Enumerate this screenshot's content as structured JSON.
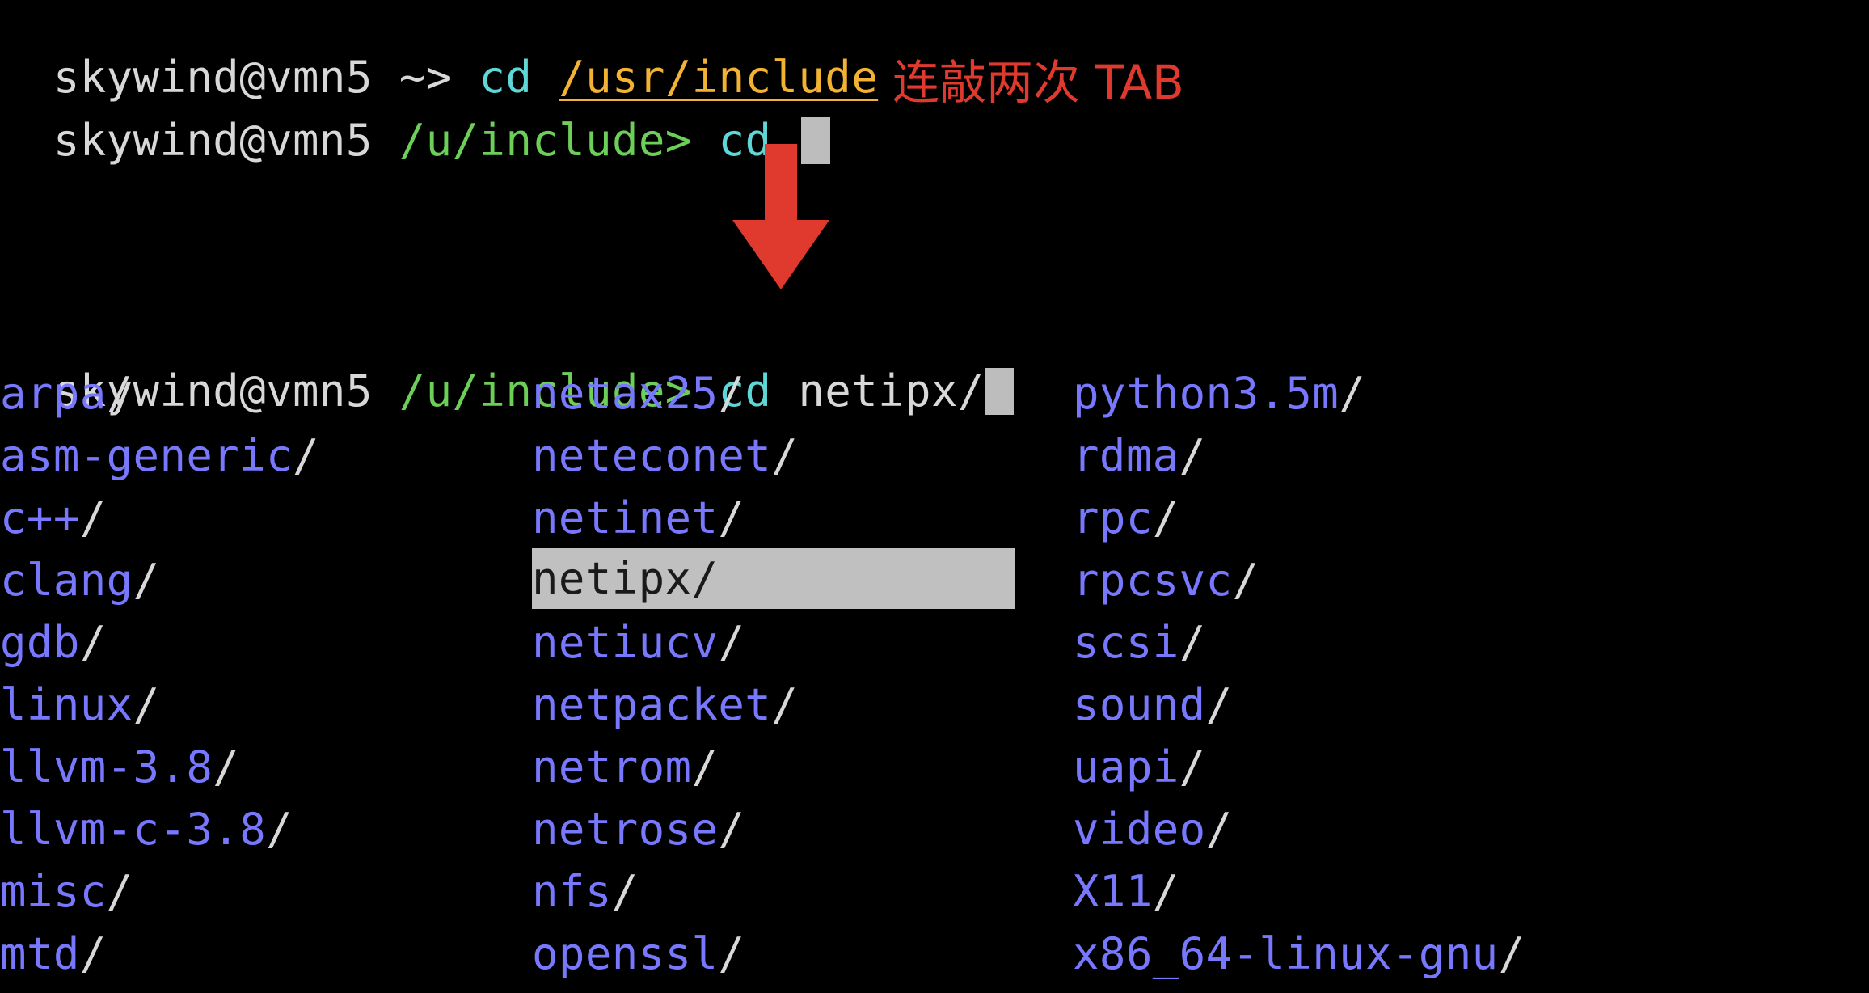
{
  "terminal": {
    "line1": {
      "user_host": "skywind@vmn5",
      "cwd": "~>",
      "command": "cd",
      "argument": "/usr/include"
    },
    "line2": {
      "user_host": "skywind@vmn5",
      "cwd": "/u/include>",
      "command": "cd"
    },
    "line3": {
      "user_host": "skywind@vmn5",
      "cwd": "/u/include>",
      "command": "cd",
      "argument": "netipx/"
    },
    "completion_columns": [
      [
        "arpa",
        "asm-generic",
        "c++",
        "clang",
        "gdb",
        "linux",
        "llvm-3.8",
        "llvm-c-3.8",
        "misc",
        "mtd"
      ],
      [
        "netax25",
        "neteconet",
        "netinet",
        "netipx",
        "netiucv",
        "netpacket",
        "netrom",
        "netrose",
        "nfs",
        "openssl"
      ],
      [
        "python3.5m",
        "rdma",
        "rpc",
        "rpcsvc",
        "scsi",
        "sound",
        "uapi",
        "video",
        "X11",
        "x86_64-linux-gnu"
      ]
    ],
    "selected_entry": "netipx",
    "dir_suffix": "/"
  },
  "annotation": {
    "text": "连敲两次 TAB",
    "color": "#e03a2e"
  },
  "icons": {
    "arrow": "down-arrow-icon"
  },
  "colors": {
    "background": "#000000",
    "directory": "#7878ff",
    "path": "#6ccf58",
    "command": "#5fd7d7",
    "argument": "#f2b233",
    "selection": "#c0c0c0"
  }
}
